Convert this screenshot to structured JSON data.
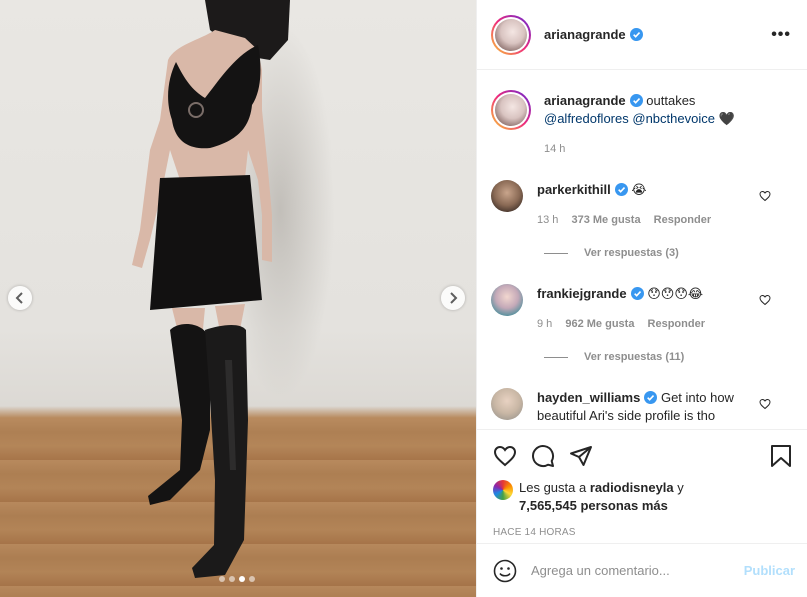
{
  "post": {
    "username": "arianagrande",
    "more_icon": "more-horizontal-icon",
    "caption_text": "outtakes",
    "caption_mentions": [
      "@alfredoflores",
      "@nbcthevoice"
    ],
    "caption_emoji": "🖤",
    "caption_time": "14 h"
  },
  "carousel": {
    "slides": 4,
    "active_slide": 3
  },
  "comments": [
    {
      "user": "parkerkithill",
      "text": "😭",
      "time": "13 h",
      "likes": "373 Me gusta",
      "reply": "Responder",
      "view_replies": "Ver respuestas (3)"
    },
    {
      "user": "frankiejgrande",
      "text": "😯😯😯😂",
      "time": "9 h",
      "likes": "962 Me gusta",
      "reply": "Responder",
      "view_replies": "Ver respuestas (11)"
    },
    {
      "user": "hayden_williams",
      "text": "Get into how beautiful Ari's side profile is tho"
    }
  ],
  "likes": {
    "prefix": "Les gusta a",
    "user": "radiodisneyla",
    "joiner": "y",
    "others": "7,565,545 personas más"
  },
  "timestamp": "HACE 14 HORAS",
  "add_comment": {
    "placeholder": "Agrega un comentario...",
    "publish": "Publicar"
  },
  "colors": {
    "verified": "#3897f0",
    "link": "#00376b",
    "publish_disabled": "#b2dffc"
  }
}
